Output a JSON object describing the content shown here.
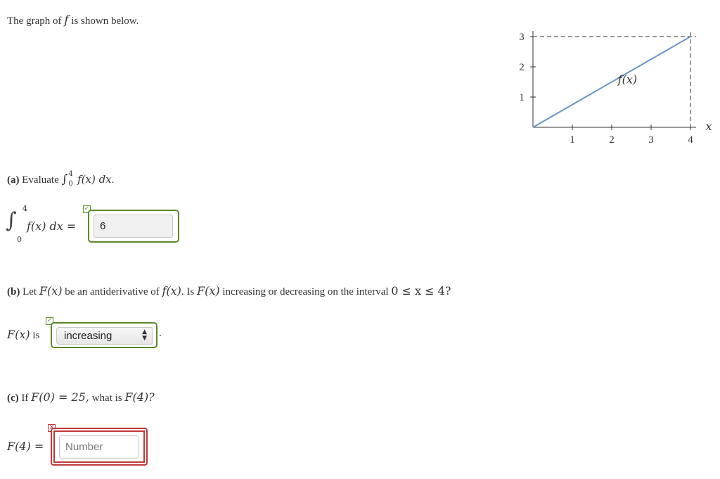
{
  "intro": {
    "text_before": "The graph of",
    "fn": "f",
    "text_after": "is shown below."
  },
  "graph": {
    "function_label": "f(x)",
    "x_axis_label": "x",
    "x_ticks": [
      "1",
      "2",
      "3",
      "4"
    ],
    "y_ticks": [
      "1",
      "2",
      "3"
    ],
    "line_color": "#6a96c8",
    "chart_data": {
      "type": "line",
      "series": [
        {
          "name": "f(x)",
          "x": [
            0,
            4
          ],
          "y": [
            0,
            3
          ]
        }
      ],
      "xlim": [
        0,
        4
      ],
      "ylim": [
        0,
        3
      ],
      "xlabel": "x",
      "annotations": [
        "f(x)",
        "dashed guide lines at x=4 and y=3"
      ]
    }
  },
  "part_a": {
    "label": "(a)",
    "prompt": "Evaluate",
    "integral_lower": "0",
    "integral_upper": "4",
    "integrand": "f(x) dx",
    "answer_lhs_integrand": "f(x) dx =",
    "answer_value": "6",
    "status": "correct",
    "status_icon": "check-icon"
  },
  "part_b": {
    "label": "(b)",
    "prompt_1": "Let",
    "F": "F(x)",
    "prompt_2": "be an antiderivative of",
    "f": "f(x)",
    "prompt_3": ". Is",
    "prompt_4": "increasing or decreasing on the interval",
    "interval": "0 ≤ x ≤ 4?",
    "answer_lhs": "F(x)",
    "answer_is": "is",
    "selected_option": "increasing",
    "trailing": ".",
    "status": "correct",
    "status_icon": "check-icon"
  },
  "part_c": {
    "label": "(c)",
    "prompt_1": "If",
    "condition": "F(0) = 25,",
    "prompt_2": "what is",
    "target": "F(4)?",
    "answer_lhs": "F(4) =",
    "answer_placeholder": "Number",
    "answer_value": "",
    "status": "incorrect",
    "status_icon": "x-icon"
  }
}
